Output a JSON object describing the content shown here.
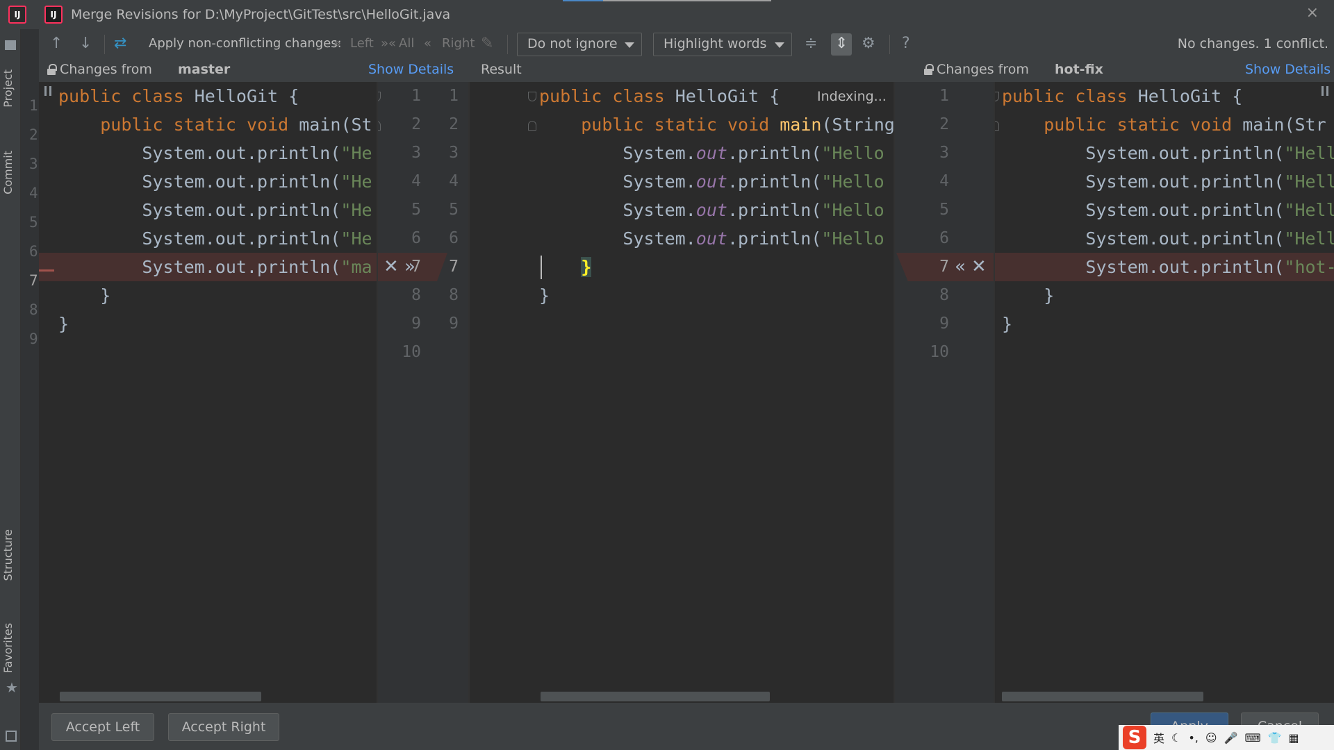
{
  "window": {
    "title": "Merge Revisions for D:\\MyProject\\GitTest\\src\\HelloGit.java",
    "app_logo": "IJ",
    "close_glyph": "×"
  },
  "left_strip": {
    "project_label": "Project",
    "commit_label": "Commit",
    "structure_label": "Structure",
    "favorites_label": "Favorites",
    "gutter_numbers": [
      "1",
      "2",
      "3",
      "4",
      "5",
      "6",
      "7",
      "8",
      "9"
    ]
  },
  "toolbar": {
    "apply_label": "Apply non-conflicting changes:",
    "left_label": "Left",
    "all_label": "All",
    "right_label": "Right",
    "ignore_combo": "Do not ignore",
    "highlight_combo": "Highlight words",
    "status": "No changes. 1 conflict."
  },
  "panels": {
    "left_header_prefix": "Changes from",
    "left_branch": "master",
    "center_header": "Result",
    "right_header_prefix": "Changes from",
    "right_branch": "hot-fix",
    "show_details": "Show Details",
    "indexing": "Indexing..."
  },
  "left_gutter_numbers": [
    "1",
    "2",
    "3",
    "4",
    "5",
    "6",
    "7",
    "8",
    "9",
    "10"
  ],
  "result_gutter_numbers": [
    "1",
    "2",
    "3",
    "4",
    "5",
    "6",
    "7",
    "8",
    "9"
  ],
  "right_gutter_numbers": [
    "1",
    "2",
    "3",
    "4",
    "5",
    "6",
    "7",
    "8",
    "9",
    "10"
  ],
  "code": {
    "class_decl": "public class HelloGit {",
    "kw_public": "public",
    "kw_class": "class",
    "kw_static": "static",
    "kw_void": "void",
    "class_name": "HelloGit",
    "left_main": "main(St",
    "center_main_name": "main",
    "center_main_args": "(String",
    "right_main": "main(Str",
    "sysout_left": "System.out.println(",
    "str_left": "\"He",
    "str_left_conflict": "\"ma",
    "sysout_prefix": "System.",
    "out_field": "out",
    "println": ".println(",
    "str_center": "\"Hello",
    "str_right": "\"Hell",
    "str_right_conflict": "\"hot-",
    "close_brace": "}",
    "open_brace": "{"
  },
  "buttons": {
    "accept_left": "Accept Left",
    "accept_right": "Accept Right",
    "apply": "Apply",
    "cancel": "Cancel"
  },
  "ime": {
    "lang": "英"
  },
  "colors": {
    "accent_blue": "#589df6",
    "conflict_bg": "#47302f",
    "keyword": "#cc7832",
    "string": "#6a8759"
  }
}
